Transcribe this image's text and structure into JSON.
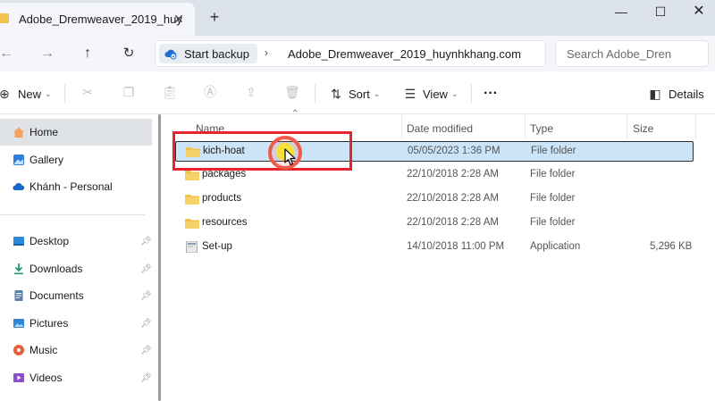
{
  "window": {
    "tab_title": "Adobe_Dremweaver_2019_huy",
    "tab_close": "✕",
    "new_tab": "+",
    "controls": {
      "minimize": "—",
      "maximize": "☐",
      "close": "✕"
    }
  },
  "address": {
    "backup_label": "Start backup",
    "breadcrumb_separator": "›",
    "breadcrumb": "Adobe_Dremweaver_2019_huynhkhang.com",
    "search_placeholder": "Search Adobe_Dren"
  },
  "toolbar": {
    "new_label": "New",
    "sort_label": "Sort",
    "view_label": "View",
    "more_label": "···",
    "details_label": "Details"
  },
  "sidebar": {
    "items": [
      {
        "label": "Home",
        "icon": "home-icon"
      },
      {
        "label": "Gallery",
        "icon": "gallery-icon"
      },
      {
        "label": "Khánh - Personal",
        "icon": "onedrive-cloud-icon"
      },
      {
        "label": "Desktop",
        "icon": "desktop-icon",
        "pinned": true
      },
      {
        "label": "Downloads",
        "icon": "download-icon",
        "pinned": true
      },
      {
        "label": "Documents",
        "icon": "documents-icon",
        "pinned": true
      },
      {
        "label": "Pictures",
        "icon": "pictures-icon",
        "pinned": true
      },
      {
        "label": "Music",
        "icon": "music-icon",
        "pinned": true
      },
      {
        "label": "Videos",
        "icon": "videos-icon",
        "pinned": true
      }
    ]
  },
  "filelist": {
    "columns": {
      "name": "Name",
      "date": "Date modified",
      "type": "Type",
      "size": "Size"
    },
    "rows": [
      {
        "name": "kich-hoat",
        "date": "05/05/2023 1:36 PM",
        "type": "File folder",
        "size": "",
        "icon": "folder-icon"
      },
      {
        "name": "packages",
        "date": "22/10/2018 2:28 AM",
        "type": "File folder",
        "size": "",
        "icon": "folder-icon"
      },
      {
        "name": "products",
        "date": "22/10/2018 2:28 AM",
        "type": "File folder",
        "size": "",
        "icon": "folder-icon"
      },
      {
        "name": "resources",
        "date": "22/10/2018 2:28 AM",
        "type": "File folder",
        "size": "",
        "icon": "folder-icon"
      },
      {
        "name": "Set-up",
        "date": "14/10/2018 11:00 PM",
        "type": "Application",
        "size": "5,296 KB",
        "icon": "application-icon"
      }
    ]
  },
  "colors": {
    "selection_bg": "#cce4f7",
    "highlight_box": "#e8232c",
    "folder": "#f2c24f",
    "titlebar_bg": "#dde3ea"
  }
}
